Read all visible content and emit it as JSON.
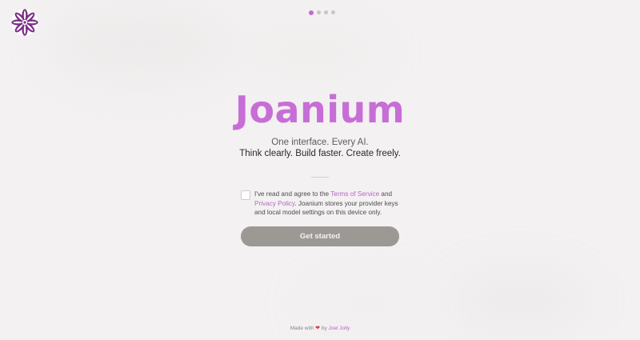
{
  "app": {
    "title": "Joanium",
    "tagline": "One interface. Every AI.",
    "subtagline": "Think clearly. Build faster. Create freely.",
    "logo_icon": "joanium-flower-logo"
  },
  "pagination": {
    "total": 4,
    "active_index": 0
  },
  "consent": {
    "checked": false,
    "text_before": "I've read and agree to the ",
    "terms_label": "Terms of Service",
    "text_and": " and ",
    "privacy_label": "Privacy Policy",
    "text_after": ". Joanium stores your provider keys and local model settings on this device only."
  },
  "actions": {
    "get_started_label": "Get started"
  },
  "footer": {
    "made_with": "Made with",
    "heart": "❤",
    "by": "by",
    "author": "Joel Jolly"
  },
  "colors": {
    "accent": "#c66ed6",
    "link": "#b866c9",
    "button_disabled": "#9c9995",
    "background": "#f3f1f1",
    "heart": "#e0334d"
  }
}
